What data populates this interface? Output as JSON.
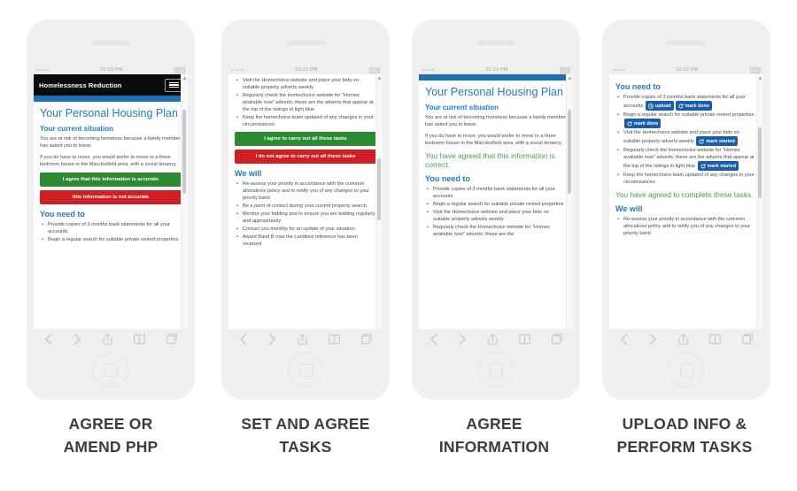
{
  "meta": {
    "status_time": "12:23 PM",
    "colors": {
      "brand_blue": "#2579c4",
      "bar_blue": "#1f6fb4",
      "agree_green": "#2c8a32",
      "disagree_red": "#cf2026",
      "confirm_green_text": "#4d9b4d",
      "pill_blue": "#1a5da9",
      "navbar_black": "#0b0b0b",
      "caption_grey": "#3d3d3d"
    }
  },
  "phones": [
    {
      "id": "phone-1",
      "caption": "AGREE OR\nAMEND PHP",
      "caption_lines": [
        "AGREE OR",
        "AMEND PHP"
      ],
      "navbar": {
        "title": "Homelessness Reduction",
        "menu_icon": "hamburger-icon"
      },
      "has_navbar": true,
      "heading": "Your Personal Housing Plan",
      "blocks": [
        {
          "type": "h2",
          "text": "Your current situation"
        },
        {
          "type": "p",
          "text": "You are at risk of becoming homeless because a family member has asked you to leave."
        },
        {
          "type": "p",
          "text": "If you do have to move, you would prefer to move to a three bedroom house in the Macclesfield area, with a social tenancy"
        },
        {
          "type": "btn-green",
          "text": "I agree that this information is accurate"
        },
        {
          "type": "btn-red",
          "text": "this information is not accurate"
        },
        {
          "type": "h2big",
          "text": "You need to"
        },
        {
          "type": "ul",
          "items": [
            "Provide copies of 3 months bank statements for all your accounts",
            "Begin a regular search for suitable private rented properties"
          ]
        }
      ]
    },
    {
      "id": "phone-2",
      "caption_lines": [
        "SET AND AGREE",
        "TASKS"
      ],
      "has_navbar": false,
      "has_bluebar": false,
      "blocks": [
        {
          "type": "ul",
          "items": [
            "Visit the Homechoice website and place your bids on suitable property adverts weekly",
            "Regularly check the Homechoice website for \"Homes available now\" adverts; these are the adverts that appear at the top of the listings in light blue",
            "Keep the homechoice team updated of any changes in your circumstances"
          ]
        },
        {
          "type": "btn-green",
          "text": "I agree to carry out all these tasks"
        },
        {
          "type": "btn-red",
          "text": "I do not agree to carry out all these tasks"
        },
        {
          "type": "h2big",
          "text": "We will"
        },
        {
          "type": "ul",
          "items": [
            "Re-assess your priority in accordance with the common allocations policy and to notify you of any changes to your priority band",
            "Be a point of contact during your current property search",
            "Monitor your bidding and to ensure you are bidding regularly and appropriately",
            "Contact you monthly for an update of your situation",
            "Award Band B now the Landlord reference has been received"
          ]
        }
      ]
    },
    {
      "id": "phone-3",
      "caption_lines": [
        "AGREE",
        "INFORMATION"
      ],
      "has_navbar": false,
      "has_bluebar": true,
      "heading": "Your Personal Housing Plan",
      "blocks": [
        {
          "type": "h2",
          "text": "Your current situation"
        },
        {
          "type": "p",
          "text": "You are at risk of becoming homeless because a family member has asked you to leave."
        },
        {
          "type": "p",
          "text": "If you do have to move, you would prefer to move to a three bedroom house in the Macclesfield area, with a social tenancy"
        },
        {
          "type": "green",
          "text": "You have agreed that this information is correct."
        },
        {
          "type": "h2big",
          "text": "You need to"
        },
        {
          "type": "ul",
          "items": [
            "Provide copies of 3 months bank statements for all your accounts",
            "Begin a regular search for suitable private rented properties",
            "Visit the Homechoice website and place your bids on suitable property adverts weekly",
            "Regularly check the Homechoice website for \"Homes available now\" adverts; these are the"
          ]
        }
      ]
    },
    {
      "id": "phone-4",
      "caption_lines": [
        "UPLOAD INFO &",
        "PERFORM TASKS"
      ],
      "has_navbar": false,
      "has_bluebar": false,
      "blocks": [
        {
          "type": "h2big",
          "text": "You need to"
        },
        {
          "type": "ul-pills",
          "items": [
            {
              "text": "Provide copies of 3 months bank statements for all your accounts",
              "pills": [
                {
                  "label": "upload",
                  "icon": "upload-clock-icon"
                },
                {
                  "label": "mark done",
                  "icon": "refresh-check-icon"
                }
              ]
            },
            {
              "text": "Begin a regular search for suitable private rented properties",
              "pills": [
                {
                  "label": "mark done",
                  "icon": "refresh-check-icon"
                }
              ]
            },
            {
              "text": "Visit the Homechoice website and place your bids on suitable property adverts weekly",
              "pills": [
                {
                  "label": "mark started",
                  "icon": "refresh-check-icon"
                }
              ]
            },
            {
              "text": "Regularly check the Homechoice website for \"Homes available now\" adverts; these are the adverts that appear at the top of the listings in light blue",
              "pills": [
                {
                  "label": "mark started",
                  "icon": "refresh-check-icon"
                }
              ]
            },
            {
              "text": "Keep the homechoice team updated of any changes in your circumstances",
              "pills": []
            }
          ]
        },
        {
          "type": "green",
          "text": "You have agreed to complete these tasks."
        },
        {
          "type": "h2big",
          "text": "We will"
        },
        {
          "type": "ul",
          "items": [
            "Re-assess your priority in accordance with the common allocations policy and to notify you of any changes to your priority band"
          ]
        }
      ]
    }
  ],
  "toolbar": {
    "icons": [
      "back-chevron-icon",
      "forward-chevron-icon",
      "share-icon",
      "bookmarks-icon",
      "tabs-icon"
    ]
  }
}
